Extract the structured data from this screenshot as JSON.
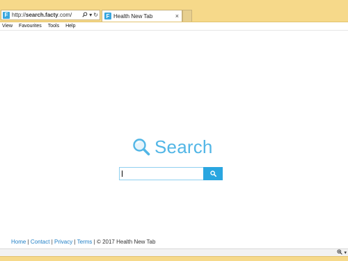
{
  "browser": {
    "address": {
      "prefix": "http://",
      "host": "search.facty",
      "suffix": ".com/"
    },
    "tab": {
      "favicon_letter": "F",
      "title": "Health New Tab",
      "close": "×"
    },
    "address_icons": {
      "search": "⚲",
      "dropdown": "▾",
      "refresh": "↻"
    }
  },
  "menubar": {
    "items": [
      "View",
      "Favourites",
      "Tools",
      "Help"
    ]
  },
  "search": {
    "logo_text": "Search",
    "input_value": "",
    "accent_color": "#52b6e6",
    "button_color": "#2aa6e0"
  },
  "footer": {
    "links": [
      "Home",
      "Contact",
      "Privacy",
      "Terms"
    ],
    "copyright": "© 2017 Health New Tab"
  },
  "statusbar": {
    "zoom_icon": "zoom-icon",
    "dropdown": "▾"
  }
}
